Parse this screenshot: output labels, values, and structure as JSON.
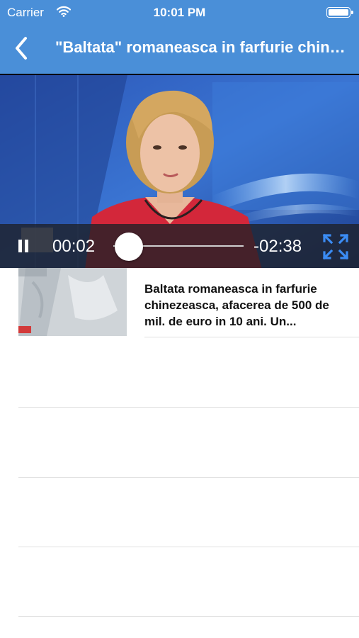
{
  "status_bar": {
    "carrier": "Carrier",
    "time": "10:01 PM",
    "icons": [
      "wifi-icon",
      "battery-icon"
    ]
  },
  "nav": {
    "back_icon": "chevron-left-icon",
    "title": "\"Baltata\" romaneasca in farfurie chinezeasca, afacerea de 500 de mil. de euro in 10 ani. Un..."
  },
  "player": {
    "elapsed": "00:02",
    "remaining": "-02:38",
    "progress_fraction": 0.0125,
    "pause_icon": "pause-icon",
    "fullscreen_icon": "fullscreen-icon"
  },
  "articles": [
    {
      "title": "Baltata romaneasca in farfurie chinezeasca, afacerea de 500 de mil. de euro in 10 ani. Un..."
    }
  ],
  "colors": {
    "header": "#4a8fd8",
    "fullscreen_accent": "#3b8cf4",
    "separator": "#e1e1e1"
  }
}
